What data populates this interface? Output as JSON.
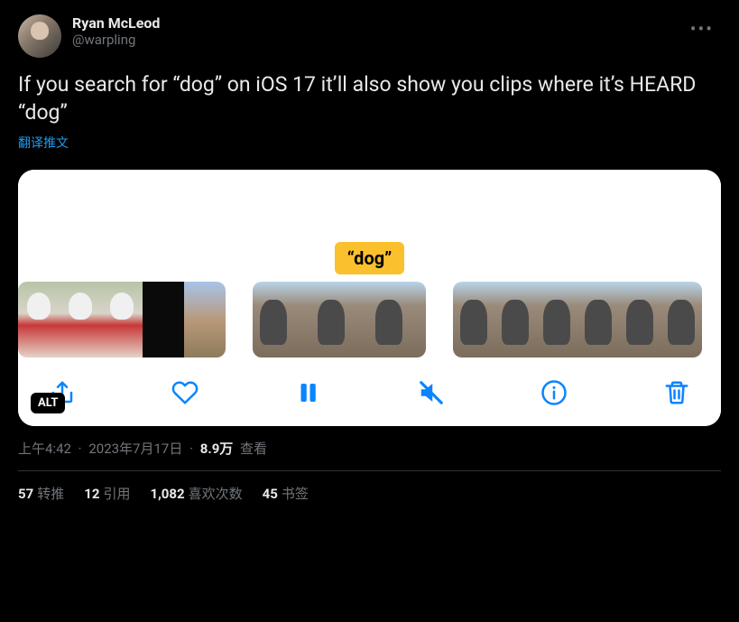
{
  "author": {
    "display_name": "Ryan McLeod",
    "handle": "@warpling"
  },
  "tweet_text": "If you search for “dog” on iOS 17 it’ll also show you clips where it’s HEARD “dog”",
  "translate_label": "翻译推文",
  "media": {
    "bubble_text": "“dog”",
    "alt_badge": "ALT",
    "toolbar": {
      "share": "share-icon",
      "like": "heart-icon",
      "pause": "pause-icon",
      "mute": "mute-icon",
      "info": "info-icon",
      "trash": "trash-icon"
    }
  },
  "meta": {
    "time": "上午4:42",
    "date": "2023年7月17日",
    "views_count": "8.9万",
    "views_label": "查看"
  },
  "stats": {
    "retweets": {
      "count": "57",
      "label": "转推"
    },
    "quotes": {
      "count": "12",
      "label": "引用"
    },
    "likes": {
      "count": "1,082",
      "label": "喜欢次数"
    },
    "bookmarks": {
      "count": "45",
      "label": "书签"
    }
  }
}
